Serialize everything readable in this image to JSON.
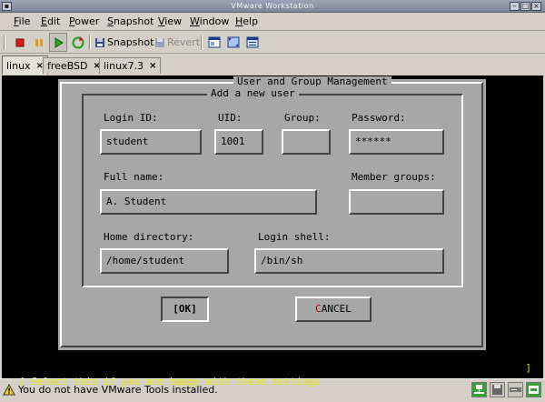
{
  "window": {
    "title": "VMware Workstation"
  },
  "menu": {
    "items": [
      {
        "underline": "F",
        "rest": "ile"
      },
      {
        "underline": "E",
        "rest": "dit"
      },
      {
        "underline": "P",
        "rest": "ower"
      },
      {
        "underline": "S",
        "rest": "napshot"
      },
      {
        "underline": "V",
        "rest": "iew"
      },
      {
        "underline": "W",
        "rest": "indow"
      },
      {
        "underline": "H",
        "rest": "elp"
      }
    ]
  },
  "toolbar": {
    "snapshot_label": "Snapshot",
    "revert_label": "Revert",
    "icons": [
      "stop-icon",
      "pause-icon",
      "play-icon",
      "reset-icon",
      "snapshot-icon",
      "revert-icon",
      "quick-switch-icon",
      "full-screen-icon",
      "summary-view-icon"
    ]
  },
  "tabs": [
    {
      "label": "linux",
      "close": "×",
      "active": true
    },
    {
      "label": "freeBSD",
      "close": "×",
      "active": false
    },
    {
      "label": "linux7.3",
      "close": "×",
      "active": false
    }
  ],
  "dialog": {
    "title": "User and Group Management",
    "subtitle": "Add a new user",
    "fields": {
      "login_id": {
        "label": "Login ID:",
        "value": "student"
      },
      "uid": {
        "label": "UID:",
        "value": "1001"
      },
      "group": {
        "label": "Group:",
        "value": ""
      },
      "password": {
        "label": "Password:",
        "value": "******"
      },
      "full_name": {
        "label": "Full name:",
        "value": "A. Student"
      },
      "member_groups": {
        "label": "Member groups:",
        "value": ""
      },
      "home_directory": {
        "label": "Home directory:",
        "value": "/home/student"
      },
      "login_shell": {
        "label": "Login shell:",
        "value": "/bin/sh"
      }
    },
    "ok_button": {
      "bracket_open": "[",
      "highlight": "OK",
      "bracket_close": "]"
    },
    "cancel_button": {
      "first": "C",
      "rest": "ANCEL"
    }
  },
  "console_status": {
    "open": "[",
    "text": " Select this if you are happy with these settings",
    "close": "]"
  },
  "statusbar": {
    "text": "You do not have VMware Tools installed.",
    "warning_icon": "warning-icon",
    "device_icons": [
      "network-icon",
      "floppy-icon",
      "cdrom-icon",
      "usb-icon"
    ]
  },
  "colors": {
    "console_bg": "#000000",
    "dialog_bg": "#a7a7a7",
    "status_yellow": "#e6e600",
    "focus_blue": "#1a1a9a",
    "cancel_red": "#b00000"
  }
}
